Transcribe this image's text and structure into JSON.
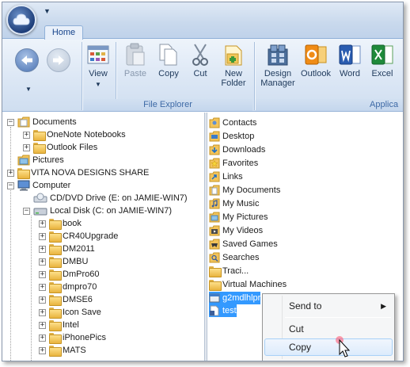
{
  "ribbon": {
    "tab_home": "Home",
    "buttons": {
      "view": "View",
      "paste": "Paste",
      "copy": "Copy",
      "cut": "Cut",
      "new_folder_line1": "New",
      "new_folder_line2": "Folder",
      "design_manager_line1": "Design",
      "design_manager_line2": "Manager",
      "outlook": "Outlook",
      "word": "Word",
      "excel": "Excel"
    },
    "groups": {
      "file_explorer": "File Explorer",
      "applications": "Applica"
    }
  },
  "tree": [
    {
      "label": "Documents",
      "expander": "−",
      "icon": "documents-folder-icon"
    },
    {
      "label": "OneNote Notebooks",
      "expander": "+",
      "icon": "folder-icon"
    },
    {
      "label": "Outlook Files",
      "expander": "+",
      "icon": "folder-icon"
    },
    {
      "label": "Pictures",
      "expander": "",
      "icon": "pictures-folder-icon"
    },
    {
      "label": "VITA NOVA DESIGNS SHARE",
      "expander": "+",
      "icon": "folder-icon"
    },
    {
      "label": "Computer",
      "expander": "−",
      "icon": "computer-icon"
    },
    {
      "label": "CD/DVD Drive (E: on JAMIE-WIN7)",
      "expander": "",
      "icon": "cd-drive-icon"
    },
    {
      "label": "Local Disk (C: on JAMIE-WIN7)",
      "expander": "−",
      "icon": "hard-disk-icon"
    },
    {
      "label": "book",
      "expander": "+",
      "icon": "folder-icon"
    },
    {
      "label": "CR40Upgrade",
      "expander": "+",
      "icon": "folder-icon"
    },
    {
      "label": "DM2011",
      "expander": "+",
      "icon": "folder-icon"
    },
    {
      "label": "DMBU",
      "expander": "+",
      "icon": "folder-icon"
    },
    {
      "label": "DmPro60",
      "expander": "+",
      "icon": "folder-icon"
    },
    {
      "label": "dmpro70",
      "expander": "+",
      "icon": "folder-icon"
    },
    {
      "label": "DMSE6",
      "expander": "+",
      "icon": "folder-icon"
    },
    {
      "label": "Icon Save",
      "expander": "+",
      "icon": "folder-icon"
    },
    {
      "label": "Intel",
      "expander": "+",
      "icon": "folder-icon"
    },
    {
      "label": "iPhonePics",
      "expander": "+",
      "icon": "folder-icon"
    },
    {
      "label": "MATS",
      "expander": "+",
      "icon": "folder-icon"
    }
  ],
  "files": [
    {
      "label": "Contacts",
      "icon": "contacts-folder-icon"
    },
    {
      "label": "Desktop",
      "icon": "desktop-folder-icon"
    },
    {
      "label": "Downloads",
      "icon": "downloads-folder-icon"
    },
    {
      "label": "Favorites",
      "icon": "favorites-folder-icon"
    },
    {
      "label": "Links",
      "icon": "links-folder-icon"
    },
    {
      "label": "My Documents",
      "icon": "documents-folder-icon"
    },
    {
      "label": "My Music",
      "icon": "music-folder-icon"
    },
    {
      "label": "My Pictures",
      "icon": "pictures-folder-icon"
    },
    {
      "label": "My Videos",
      "icon": "videos-folder-icon"
    },
    {
      "label": "Saved Games",
      "icon": "saved-games-folder-icon"
    },
    {
      "label": "Searches",
      "icon": "searches-folder-icon"
    },
    {
      "label": "Traci...",
      "icon": "folder-icon"
    },
    {
      "label": "Virtual Machines",
      "icon": "folder-icon"
    },
    {
      "label": "g2mdlhlpr",
      "icon": "program-file-icon",
      "selected": true
    },
    {
      "label": "test",
      "icon": "file-icon",
      "selected": true
    }
  ],
  "context_menu": {
    "send_to": "Send to",
    "cut": "Cut",
    "copy": "Copy"
  },
  "colors": {
    "selection": "#3399ff",
    "ribbon_text": "#1e395b",
    "group_label": "#3e6aa6"
  }
}
